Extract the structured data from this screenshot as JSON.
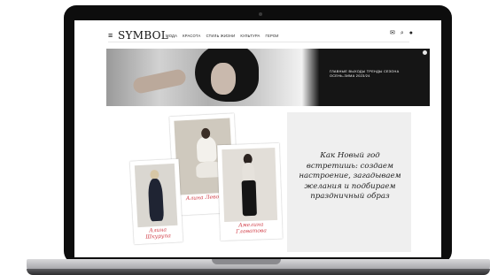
{
  "header": {
    "logo": "SYMBOL",
    "nav": [
      "МОДА",
      "КРАСОТА",
      "СТИЛЬ ЖИЗНИ",
      "КУЛЬТУРА",
      "ГЕРОИ"
    ]
  },
  "hero": {
    "text": "ГЛАВНЫЕ ВЫХОДЫ ТРЕНДЫ СЕЗОНА ОСЕНЬ-ЗИМА 2023/24"
  },
  "article": {
    "headline": "Как Новый год встретишь: создаем настроение, загадываем желания и подбираем праздничный образ",
    "captions": [
      "Алина Шкурупа",
      "Алина Левоян",
      "Амелина Главатова"
    ]
  },
  "colors": {
    "accent": "#d13e48",
    "frame": "#0d0d0d",
    "quote_bg": "#efefef"
  }
}
